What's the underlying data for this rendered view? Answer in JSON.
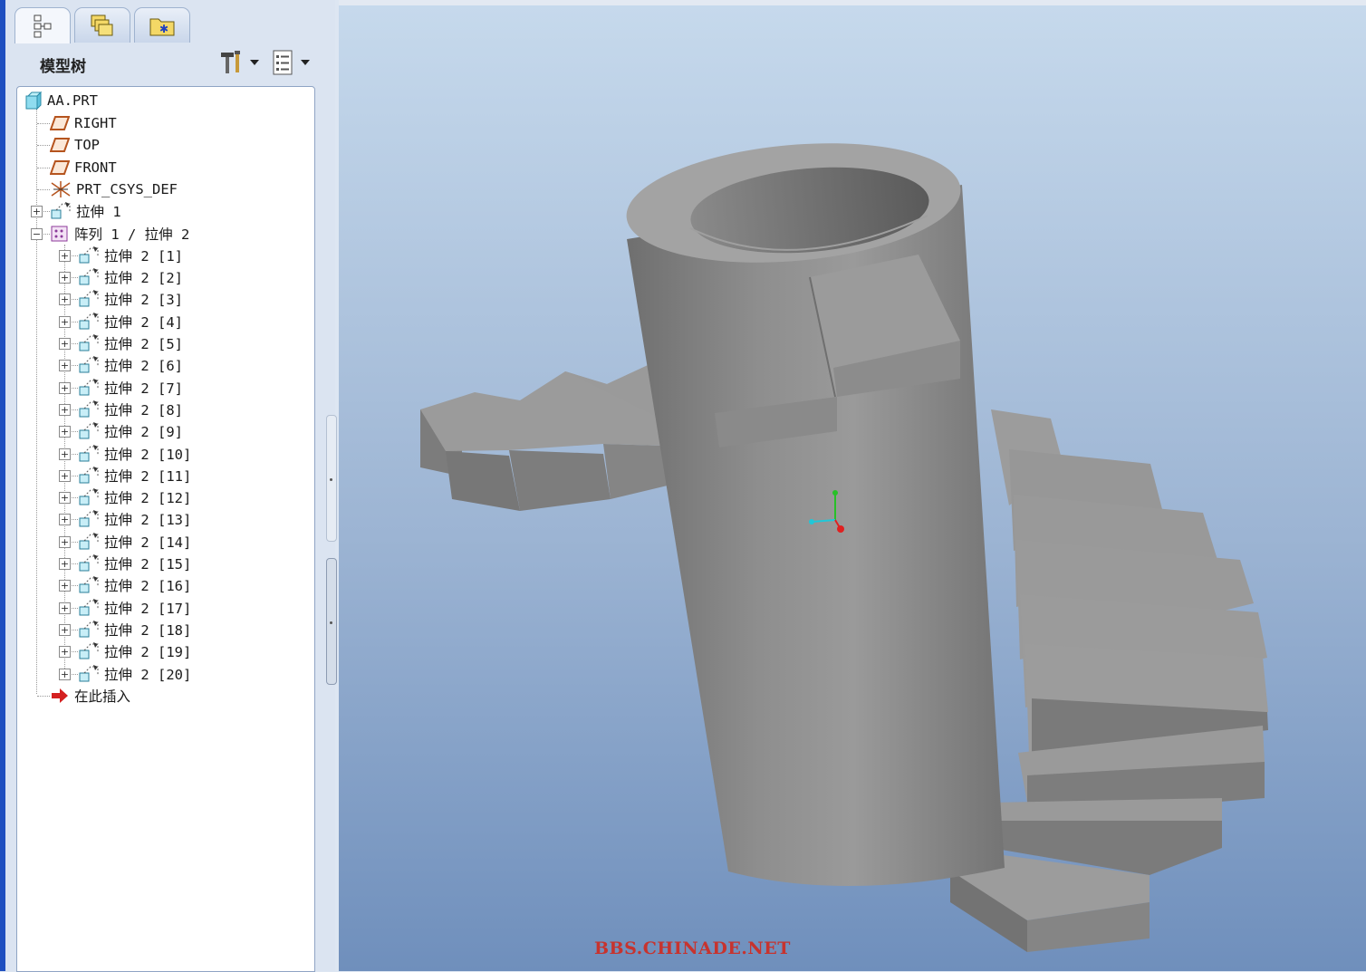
{
  "panel": {
    "tabs": [
      {
        "name": "model-tree-tab-icon",
        "active": true
      },
      {
        "name": "layers-tab-icon",
        "active": false
      },
      {
        "name": "favorites-folder-tab-icon",
        "active": false
      }
    ],
    "title": "模型树",
    "settings_icon": "tools-settings-icon",
    "show_icon": "list-show-icon"
  },
  "tree": {
    "root": "AA.PRT",
    "rows": [
      {
        "label": "RIGHT",
        "icon": "datum-plane",
        "level": 1,
        "expander": ""
      },
      {
        "label": "TOP",
        "icon": "datum-plane",
        "level": 1,
        "expander": ""
      },
      {
        "label": "FRONT",
        "icon": "datum-plane",
        "level": 1,
        "expander": ""
      },
      {
        "label": "PRT_CSYS_DEF",
        "icon": "csys",
        "level": 1,
        "expander": ""
      },
      {
        "label": "拉伸 1",
        "icon": "extrude",
        "level": 1,
        "expander": "+"
      },
      {
        "label": "阵列 1 / 拉伸 2",
        "icon": "pattern",
        "level": 1,
        "expander": "−"
      },
      {
        "label": "拉伸 2 [1]",
        "icon": "extrude",
        "level": 2,
        "expander": "+"
      },
      {
        "label": "拉伸 2 [2]",
        "icon": "extrude",
        "level": 2,
        "expander": "+"
      },
      {
        "label": "拉伸 2 [3]",
        "icon": "extrude",
        "level": 2,
        "expander": "+"
      },
      {
        "label": "拉伸 2 [4]",
        "icon": "extrude",
        "level": 2,
        "expander": "+"
      },
      {
        "label": "拉伸 2 [5]",
        "icon": "extrude",
        "level": 2,
        "expander": "+"
      },
      {
        "label": "拉伸 2 [6]",
        "icon": "extrude",
        "level": 2,
        "expander": "+"
      },
      {
        "label": "拉伸 2 [7]",
        "icon": "extrude",
        "level": 2,
        "expander": "+"
      },
      {
        "label": "拉伸 2 [8]",
        "icon": "extrude",
        "level": 2,
        "expander": "+"
      },
      {
        "label": "拉伸 2 [9]",
        "icon": "extrude",
        "level": 2,
        "expander": "+"
      },
      {
        "label": "拉伸 2 [10]",
        "icon": "extrude",
        "level": 2,
        "expander": "+"
      },
      {
        "label": "拉伸 2 [11]",
        "icon": "extrude",
        "level": 2,
        "expander": "+"
      },
      {
        "label": "拉伸 2 [12]",
        "icon": "extrude",
        "level": 2,
        "expander": "+"
      },
      {
        "label": "拉伸 2 [13]",
        "icon": "extrude",
        "level": 2,
        "expander": "+"
      },
      {
        "label": "拉伸 2 [14]",
        "icon": "extrude",
        "level": 2,
        "expander": "+"
      },
      {
        "label": "拉伸 2 [15]",
        "icon": "extrude",
        "level": 2,
        "expander": "+"
      },
      {
        "label": "拉伸 2 [16]",
        "icon": "extrude",
        "level": 2,
        "expander": "+"
      },
      {
        "label": "拉伸 2 [17]",
        "icon": "extrude",
        "level": 2,
        "expander": "+"
      },
      {
        "label": "拉伸 2 [18]",
        "icon": "extrude",
        "level": 2,
        "expander": "+"
      },
      {
        "label": "拉伸 2 [19]",
        "icon": "extrude",
        "level": 2,
        "expander": "+"
      },
      {
        "label": "拉伸 2 [20]",
        "icon": "extrude",
        "level": 2,
        "expander": "+"
      },
      {
        "label": "在此插入",
        "icon": "insert-arrow",
        "level": 1,
        "expander": ""
      }
    ]
  },
  "viewport": {
    "watermark": "BBS.CHINADE.NET"
  },
  "colors": {
    "model_gray": "#8c8c8c",
    "viewport_top": "#c6d9ec",
    "viewport_bottom": "#6f8fbc",
    "insert_arrow": "#d42020",
    "datum_plane": "#b5541e"
  }
}
